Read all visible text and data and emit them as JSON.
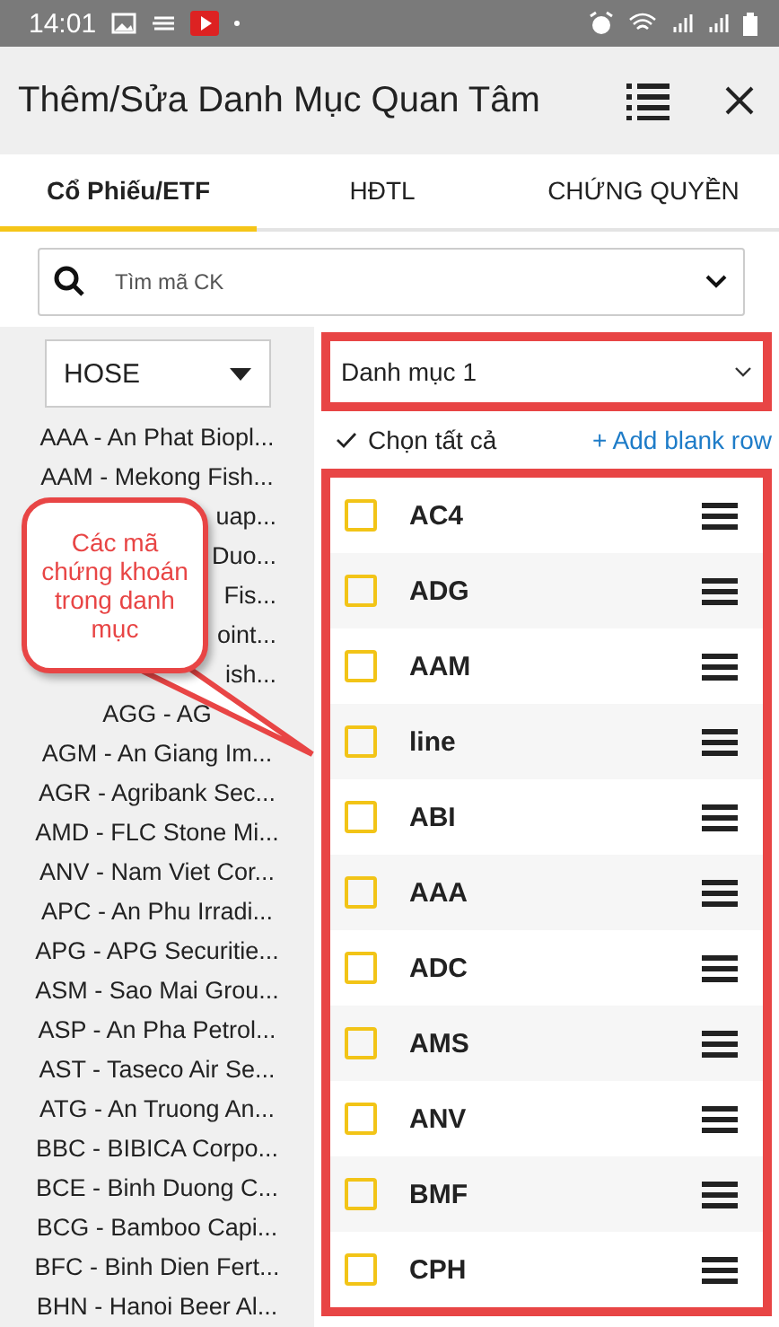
{
  "status_bar": {
    "time": "14:01"
  },
  "header": {
    "title": "Thêm/Sửa Danh Mục Quan Tâm"
  },
  "tabs": [
    {
      "label": "Cổ Phiếu/ETF",
      "selected": true
    },
    {
      "label": "HĐTL",
      "selected": false
    },
    {
      "label": "CHỨNG QUYỀN",
      "selected": false
    }
  ],
  "search": {
    "placeholder": "Tìm mã CK"
  },
  "exchange_select": {
    "value": "HOSE"
  },
  "stock_list": [
    {
      "text": "AAA - An Phat Biopl..."
    },
    {
      "text": "AAM - Mekong Fish..."
    },
    {
      "text": "uap...",
      "kind": "partial"
    },
    {
      "text": "Duo...",
      "kind": "partial"
    },
    {
      "text": "Fis...",
      "kind": "partial"
    },
    {
      "text": "oint...",
      "kind": "partial"
    },
    {
      "text": "ish...",
      "kind": "partial"
    },
    {
      "text": "AGG - AG"
    },
    {
      "text": "AGM - An Giang Im..."
    },
    {
      "text": "AGR - Agribank Sec..."
    },
    {
      "text": "AMD - FLC Stone Mi..."
    },
    {
      "text": "ANV - Nam Viet Cor..."
    },
    {
      "text": "APC - An Phu Irradi..."
    },
    {
      "text": "APG - APG Securitie..."
    },
    {
      "text": "ASM - Sao Mai Grou..."
    },
    {
      "text": "ASP - An Pha Petrol..."
    },
    {
      "text": "AST - Taseco Air Se..."
    },
    {
      "text": "ATG - An Truong An..."
    },
    {
      "text": "BBC - BIBICA Corpo..."
    },
    {
      "text": "BCE - Binh Duong C..."
    },
    {
      "text": "BCG - Bamboo Capi..."
    },
    {
      "text": "BFC - Binh Dien Fert..."
    },
    {
      "text": "BHN - Hanoi Beer Al..."
    }
  ],
  "watchlist_select": {
    "value": "Danh mục 1"
  },
  "select_all": "Chọn tất cả",
  "add_row": "+ Add blank row",
  "watchlist": [
    {
      "symbol": "AC4",
      "checked": false
    },
    {
      "symbol": "ADG",
      "checked": false
    },
    {
      "symbol": "AAM",
      "checked": false
    },
    {
      "symbol": "line",
      "checked": false
    },
    {
      "symbol": "ABI",
      "checked": false
    },
    {
      "symbol": "AAA",
      "checked": false
    },
    {
      "symbol": "ADC",
      "checked": false
    },
    {
      "symbol": "AMS",
      "checked": false
    },
    {
      "symbol": "ANV",
      "checked": false
    },
    {
      "symbol": "BMF",
      "checked": false
    },
    {
      "symbol": "CPH",
      "checked": false
    }
  ],
  "callout": {
    "text": "Các mã chứng khoán trong danh mục"
  }
}
